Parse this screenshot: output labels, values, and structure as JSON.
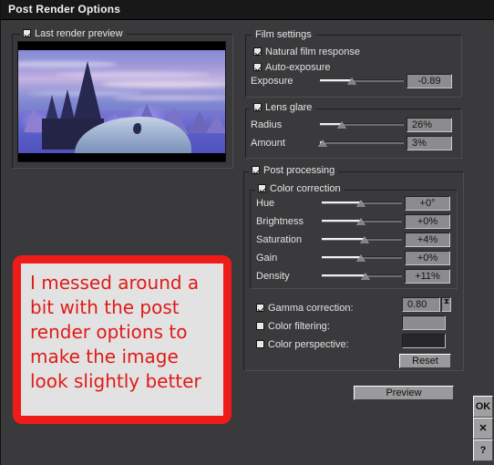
{
  "window": {
    "title": "Post Render Options"
  },
  "preview_group": {
    "label": "Last render preview",
    "checked": true
  },
  "film_settings": {
    "title": "Film settings",
    "natural_film_response": {
      "label": "Natural film response",
      "checked": true
    },
    "auto_exposure": {
      "label": "Auto-exposure",
      "checked": true
    },
    "exposure": {
      "label": "Exposure",
      "value": "-0.89",
      "position_pct": 38
    }
  },
  "lens_glare": {
    "title": "Lens glare",
    "checked": true,
    "radius": {
      "label": "Radius",
      "value": "26%",
      "position_pct": 26
    },
    "amount": {
      "label": "Amount",
      "value": "3%",
      "position_pct": 3
    }
  },
  "post_processing": {
    "title": "Post processing",
    "checked": true,
    "color_correction": {
      "title": "Color correction",
      "checked": true,
      "sliders": [
        {
          "label": "Hue",
          "value": "+0°",
          "position_pct": 49
        },
        {
          "label": "Brightness",
          "value": "+0%",
          "position_pct": 49
        },
        {
          "label": "Saturation",
          "value": "+4%",
          "position_pct": 53
        },
        {
          "label": "Gain",
          "value": "+0%",
          "position_pct": 49
        },
        {
          "label": "Density",
          "value": "+11%",
          "position_pct": 55
        }
      ]
    },
    "gamma_correction": {
      "label": "Gamma correction:",
      "checked": true,
      "value": "0.80"
    },
    "color_filtering": {
      "label": "Color filtering:",
      "checked": false,
      "swatch": "#8d8d8f"
    },
    "color_perspective": {
      "label": "Color perspective:",
      "checked": false,
      "swatch": "#272729"
    },
    "reset_button": "Reset"
  },
  "buttons": {
    "preview": "Preview",
    "ok": "OK",
    "cancel": "✕",
    "help": "?"
  },
  "annotation": {
    "text": "I messed around a bit with the post render options to make the image look slightly better",
    "border_color": "#ee1b18",
    "text_color": "#e01a16"
  }
}
